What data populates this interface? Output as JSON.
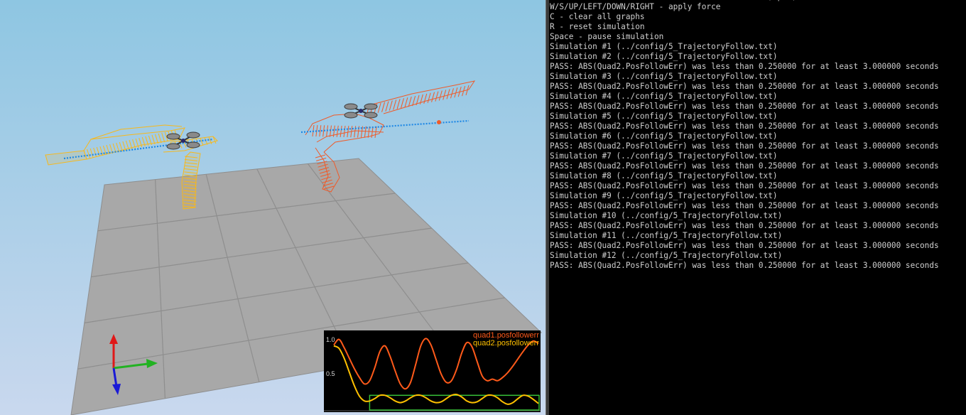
{
  "console": {
    "lines": [
      "LEFT DRAG / X+LEFT DRAG / Z+LEFT DRAG = rotate, pan, zoom camera",
      "W/S/UP/LEFT/DOWN/RIGHT - apply force",
      "C - clear all graphs",
      "R - reset simulation",
      "Space - pause simulation",
      "Simulation #1 (../config/5_TrajectoryFollow.txt)",
      "Simulation #2 (../config/5_TrajectoryFollow.txt)",
      "PASS: ABS(Quad2.PosFollowErr) was less than 0.250000 for at least 3.000000 seconds",
      "Simulation #3 (../config/5_TrajectoryFollow.txt)",
      "PASS: ABS(Quad2.PosFollowErr) was less than 0.250000 for at least 3.000000 seconds",
      "Simulation #4 (../config/5_TrajectoryFollow.txt)",
      "PASS: ABS(Quad2.PosFollowErr) was less than 0.250000 for at least 3.000000 seconds",
      "Simulation #5 (../config/5_TrajectoryFollow.txt)",
      "PASS: ABS(Quad2.PosFollowErr) was less than 0.250000 for at least 3.000000 seconds",
      "Simulation #6 (../config/5_TrajectoryFollow.txt)",
      "PASS: ABS(Quad2.PosFollowErr) was less than 0.250000 for at least 3.000000 seconds",
      "Simulation #7 (../config/5_TrajectoryFollow.txt)",
      "PASS: ABS(Quad2.PosFollowErr) was less than 0.250000 for at least 3.000000 seconds",
      "Simulation #8 (../config/5_TrajectoryFollow.txt)",
      "PASS: ABS(Quad2.PosFollowErr) was less than 0.250000 for at least 3.000000 seconds",
      "Simulation #9 (../config/5_TrajectoryFollow.txt)",
      "PASS: ABS(Quad2.PosFollowErr) was less than 0.250000 for at least 3.000000 seconds",
      "Simulation #10 (../config/5_TrajectoryFollow.txt)",
      "PASS: ABS(Quad2.PosFollowErr) was less than 0.250000 for at least 3.000000 seconds",
      "Simulation #11 (../config/5_TrajectoryFollow.txt)",
      "PASS: ABS(Quad2.PosFollowErr) was less than 0.250000 for at least 3.000000 seconds",
      "Simulation #12 (../config/5_TrajectoryFollow.txt)",
      "PASS: ABS(Quad2.PosFollowErr) was less than 0.250000 for at least 3.000000 seconds"
    ]
  },
  "scene": {
    "sky_top_color": "#8ec6e2",
    "sky_bottom_color": "#c9d8ee",
    "ground_color": "#a8a8a8",
    "ground_grid_color": "#8e8e8e",
    "quad1_trail_color": "#f05a28",
    "quad2_trail_color": "#f7b81c",
    "target_path_color": "#1e88e5",
    "axis_x_color": "#22b222",
    "axis_y_color": "#1a1ad6",
    "axis_z_color": "#e01818",
    "icons": [
      "quadrotor-icon",
      "quadrotor-icon",
      "axis-gizmo-icon"
    ]
  },
  "graph": {
    "legend": [
      {
        "label": "quad1.posfollowerr",
        "color": "#ff5a1a"
      },
      {
        "label": "quad2.posfollowerr",
        "color": "#ffc000"
      }
    ],
    "yticks": [
      "1.0",
      "0.5"
    ],
    "threshold_box_color": "#38c038"
  },
  "chart_data": {
    "type": "line",
    "title": "",
    "xlabel": "",
    "ylabel": "",
    "ylim": [
      0.15,
      1.07
    ],
    "x": [
      0,
      0.3,
      0.6,
      0.9,
      1.2,
      1.5,
      1.8,
      2.1,
      2.4,
      2.7,
      3.0,
      3.3,
      3.6,
      3.9,
      4.2,
      4.5,
      4.8,
      5.1,
      5.4,
      5.7,
      6.0,
      6.3,
      6.6,
      6.9,
      7.2,
      7.5,
      7.8,
      8.1,
      8.4,
      8.7,
      9.0,
      9.3,
      9.6,
      9.9,
      10.2,
      10.5,
      10.8,
      11.1,
      11.4,
      11.7,
      12.0
    ],
    "series": [
      {
        "name": "quad1.posfollowerr",
        "color": "#ff5a1a",
        "values": [
          0.96,
          1.03,
          0.93,
          0.8,
          0.67,
          0.56,
          0.48,
          0.52,
          0.68,
          0.88,
          0.95,
          0.82,
          0.64,
          0.48,
          0.42,
          0.5,
          0.72,
          0.95,
          1.04,
          0.96,
          0.78,
          0.6,
          0.5,
          0.52,
          0.66,
          0.86,
          0.99,
          0.94,
          0.76,
          0.58,
          0.52,
          0.54,
          0.52,
          0.56,
          0.62,
          0.7,
          0.79,
          0.88,
          0.96,
          1.01,
          0.98
        ]
      },
      {
        "name": "quad2.posfollowerr",
        "color": "#ffc000",
        "values": [
          0.95,
          0.92,
          0.8,
          0.63,
          0.46,
          0.33,
          0.27,
          0.27,
          0.3,
          0.34,
          0.34,
          0.31,
          0.27,
          0.25,
          0.27,
          0.31,
          0.34,
          0.34,
          0.31,
          0.27,
          0.25,
          0.26,
          0.3,
          0.34,
          0.35,
          0.32,
          0.27,
          0.25,
          0.26,
          0.3,
          0.34,
          0.34,
          0.31,
          0.26,
          0.23,
          0.25,
          0.3,
          0.34,
          0.33,
          0.29,
          0.24
        ]
      }
    ],
    "threshold": {
      "value": 0.25,
      "duration_seconds": 3.0
    }
  }
}
